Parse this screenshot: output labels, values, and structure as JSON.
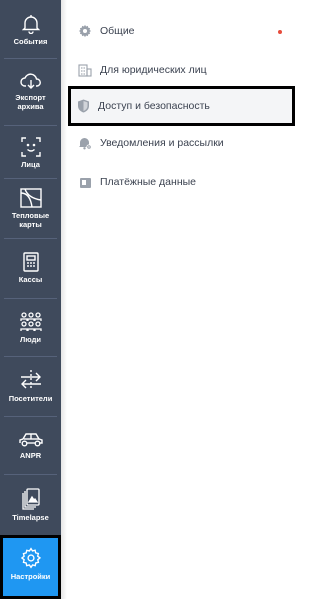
{
  "sidebar": {
    "items": [
      {
        "label": "События",
        "icon": "bell-icon"
      },
      {
        "label": "Экспорт архива",
        "icon": "cloud-download-icon"
      },
      {
        "label": "Лица",
        "icon": "face-icon"
      },
      {
        "label": "Тепловые карты",
        "icon": "heatmap-icon"
      },
      {
        "label": "Кассы",
        "icon": "cash-register-icon"
      },
      {
        "label": "Люди",
        "icon": "people-icon"
      },
      {
        "label": "Посетители",
        "icon": "visitors-icon"
      },
      {
        "label": "ANPR",
        "icon": "car-icon"
      },
      {
        "label": "Timelapse",
        "icon": "timelapse-icon"
      },
      {
        "label": "Настройки",
        "icon": "gear-icon",
        "active": true
      }
    ]
  },
  "settings_menu": {
    "items": [
      {
        "label": "Общие",
        "icon": "gear-icon",
        "has_notification": true
      },
      {
        "label": "Для юридических лиц",
        "icon": "building-icon"
      },
      {
        "label": "Доступ и безопасность",
        "icon": "shield-icon",
        "selected": true
      },
      {
        "label": "Уведомления и рассылки",
        "icon": "bell-gear-icon"
      },
      {
        "label": "Платёжные данные",
        "icon": "wallet-icon"
      }
    ]
  },
  "colors": {
    "sidebar_bg": "#3f4a5c",
    "active_bg": "#1f97f2",
    "notification_dot": "#e74c3c",
    "menu_icon": "#9aa1ab"
  }
}
